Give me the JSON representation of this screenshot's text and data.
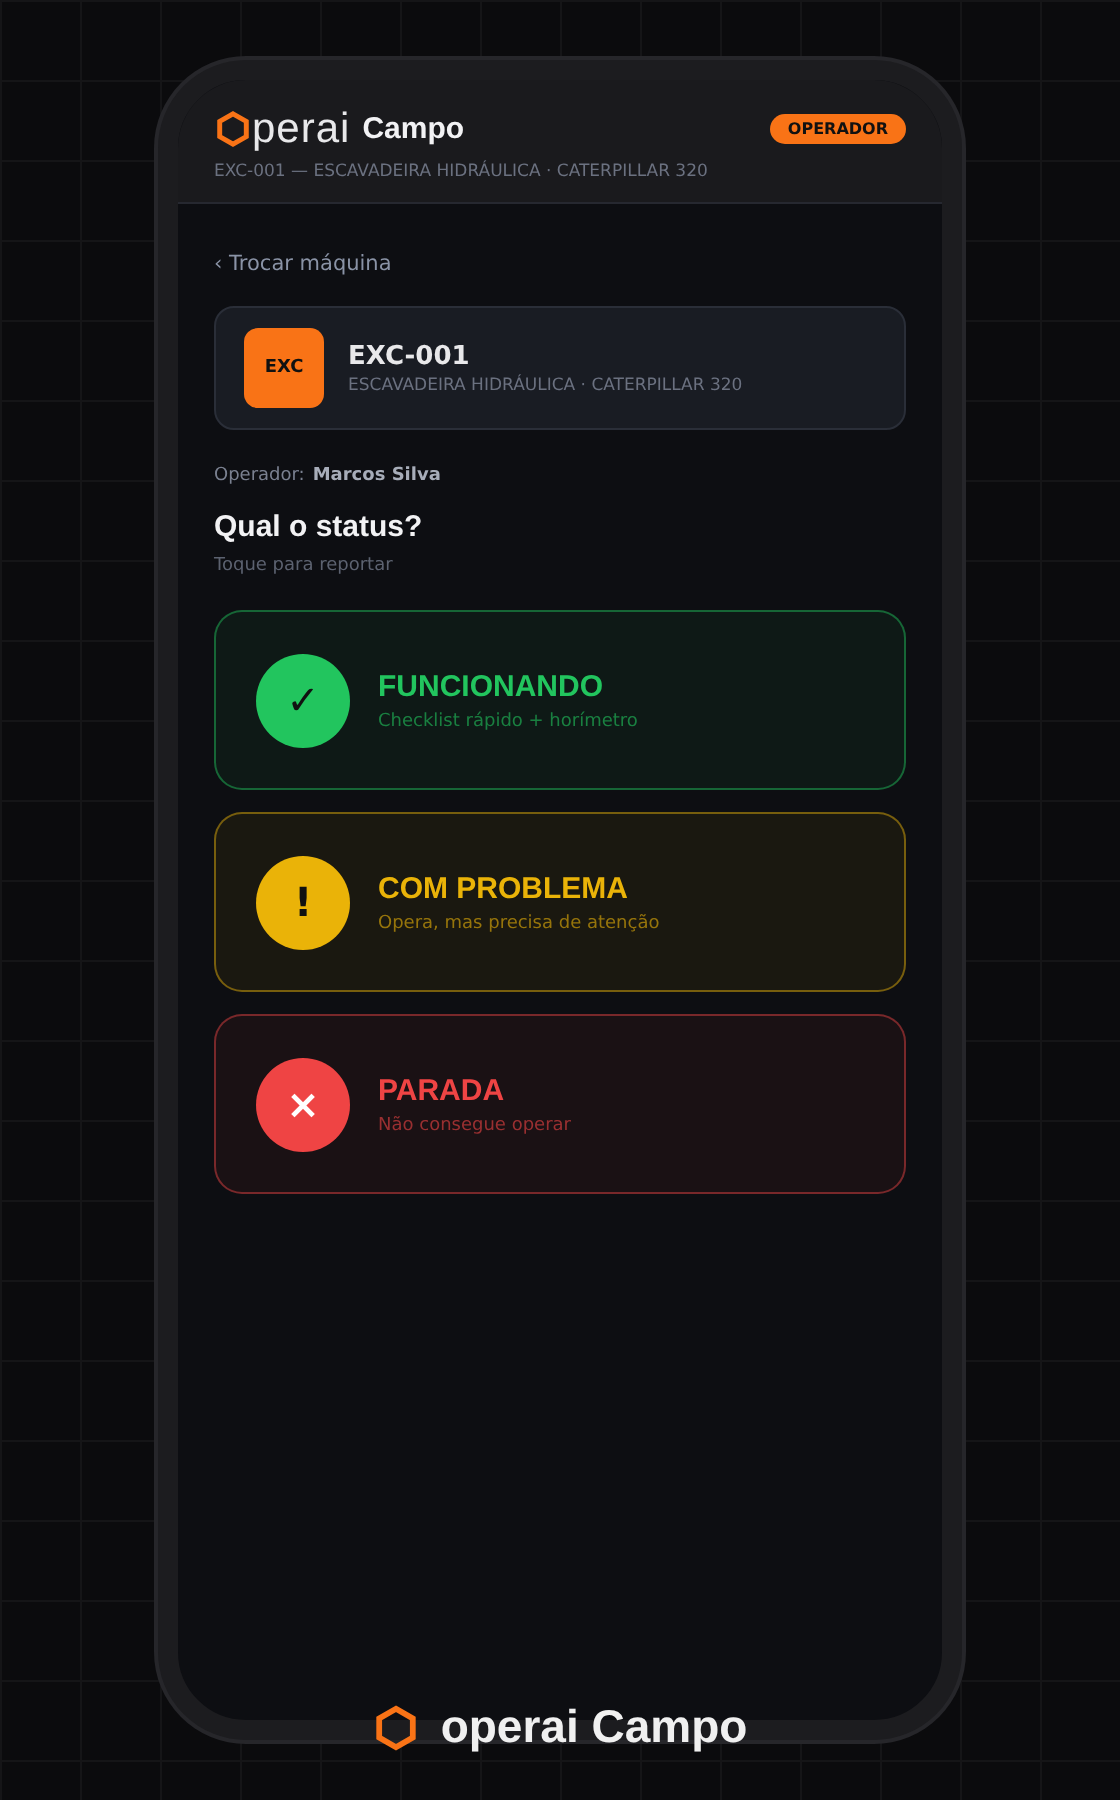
{
  "header": {
    "logo_text": "perai",
    "product": "Campo",
    "role_badge": "OPERADOR",
    "subtitle": "EXC-001 — ESCAVADEIRA HIDRÁULICA · CATERPILLAR 320"
  },
  "back_link": "‹ Trocar máquina",
  "machine": {
    "badge": "EXC",
    "code": "EXC-001",
    "description": "ESCAVADEIRA HIDRÁULICA · CATERPILLAR 320"
  },
  "operator": {
    "label": "Operador:",
    "name": "Marcos Silva"
  },
  "question": "Qual o status?",
  "hint": "Toque para reportar",
  "options": [
    {
      "symbol": "✓",
      "title": "FUNCIONANDO",
      "subtitle": "Checklist rápido + horímetro",
      "color": "#22c55e"
    },
    {
      "symbol": "!",
      "title": "COM PROBLEMA",
      "subtitle": "Opera, mas precisa de atenção",
      "color": "#eab308"
    },
    {
      "symbol": "×",
      "title": "PARADA",
      "subtitle": "Não consegue operar",
      "color": "#ef4444"
    }
  ],
  "footer": "operai Campo"
}
